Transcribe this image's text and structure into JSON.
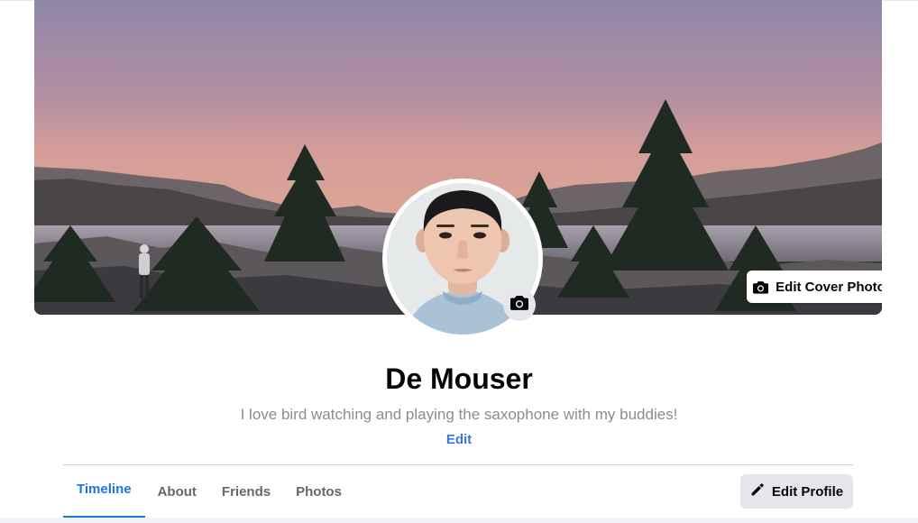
{
  "cover": {
    "edit_cover_label": "Edit Cover Photo",
    "edit_cover_icon": "camera-icon"
  },
  "avatar": {
    "camera_icon": "camera-icon"
  },
  "profile": {
    "name": "De Mouser",
    "bio": "I love bird watching and playing the saxophone with my buddies!",
    "bio_edit_label": "Edit"
  },
  "tabs": [
    {
      "label": "Timeline",
      "active": true
    },
    {
      "label": "About",
      "active": false
    },
    {
      "label": "Friends",
      "active": false
    },
    {
      "label": "Photos",
      "active": false
    }
  ],
  "actions": {
    "edit_profile_label": "Edit Profile",
    "edit_profile_icon": "pencil-icon"
  },
  "colors": {
    "accent": "#1b74e4",
    "link": "#3578e5",
    "button_bg": "#e4e6eb",
    "bio_text": "#8a8d91"
  }
}
